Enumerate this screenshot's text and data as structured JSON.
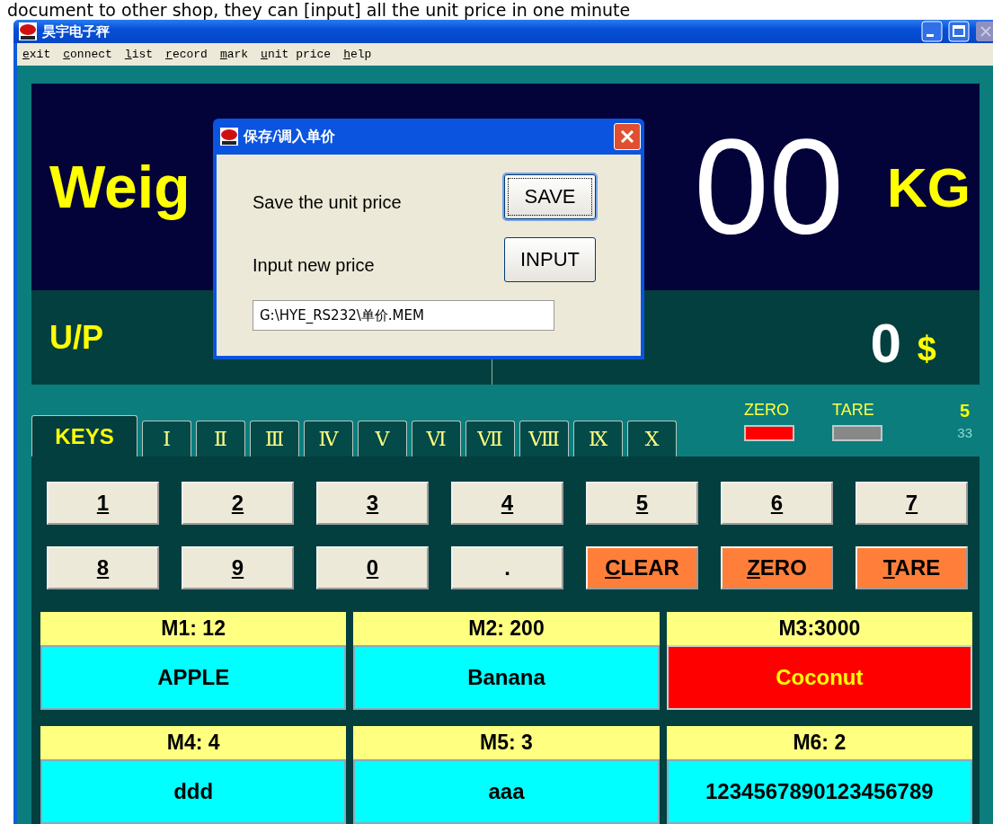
{
  "caption": "document to other shop, they can [input] all the unit price in one minute",
  "window": {
    "title": "昊宇电子秤"
  },
  "menu": [
    "exit",
    "connect",
    "list",
    "record",
    "mark",
    "unit price",
    "help"
  ],
  "weight_panel": {
    "label": "Weig",
    "reading": "00",
    "unit": "KG"
  },
  "price_panel": {
    "label": "U/P",
    "value": "0",
    "currency": "$"
  },
  "tabs": [
    {
      "label": "KEYS",
      "selected": true
    },
    {
      "label": "Ⅰ",
      "selected": false
    },
    {
      "label": "Ⅱ",
      "selected": false
    },
    {
      "label": "Ⅲ",
      "selected": false
    },
    {
      "label": "Ⅳ",
      "selected": false
    },
    {
      "label": "Ⅴ",
      "selected": false
    },
    {
      "label": "Ⅵ",
      "selected": false
    },
    {
      "label": "Ⅶ",
      "selected": false
    },
    {
      "label": "Ⅷ",
      "selected": false
    },
    {
      "label": "Ⅸ",
      "selected": false
    },
    {
      "label": "Ⅹ",
      "selected": false
    }
  ],
  "indicators": [
    {
      "label": "ZERO",
      "on": true
    },
    {
      "label": "TARE",
      "on": false
    }
  ],
  "counter": "5",
  "sub_counter": "33",
  "keys": [
    {
      "label": "1",
      "kind": "digit"
    },
    {
      "label": "2",
      "kind": "digit"
    },
    {
      "label": "3",
      "kind": "digit"
    },
    {
      "label": "4",
      "kind": "digit"
    },
    {
      "label": "5",
      "kind": "digit"
    },
    {
      "label": "6",
      "kind": "digit"
    },
    {
      "label": "7",
      "kind": "digit"
    },
    {
      "label": "8",
      "kind": "digit"
    },
    {
      "label": "9",
      "kind": "digit"
    },
    {
      "label": "0",
      "kind": "digit"
    },
    {
      "label": ".",
      "kind": "digit"
    },
    {
      "label": "CLEAR",
      "kind": "function"
    },
    {
      "label": "ZERO",
      "kind": "function"
    },
    {
      "label": "TARE",
      "kind": "function"
    }
  ],
  "memory": [
    {
      "header": "M1: 12",
      "name": "APPLE",
      "selected": false
    },
    {
      "header": "M2: 200",
      "name": "Banana",
      "selected": false
    },
    {
      "header": "M3:3000",
      "name": "Coconut",
      "selected": true
    },
    {
      "header": "M4: 4",
      "name": "ddd",
      "selected": false
    },
    {
      "header": "M5: 3",
      "name": "aaa",
      "selected": false
    },
    {
      "header": "M6: 2",
      "name": "1234567890123456789",
      "selected": false
    }
  ],
  "dialog": {
    "title": "保存/调入单价",
    "rows": [
      {
        "label": "Save the unit price",
        "button": "SAVE",
        "focused": true
      },
      {
        "label": "Input new price",
        "button": "INPUT",
        "focused": false
      }
    ],
    "path": "G:\\HYE_RS232\\单价.MEM"
  }
}
